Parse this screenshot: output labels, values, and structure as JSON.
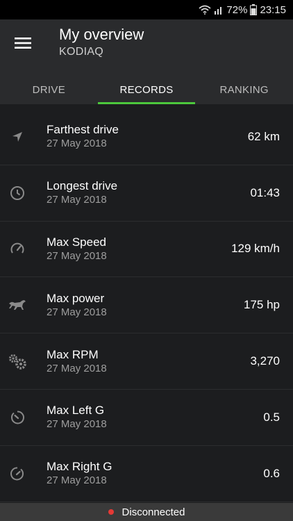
{
  "status_bar": {
    "battery": "72%",
    "time": "23:15"
  },
  "header": {
    "title": "My overview",
    "subtitle": "KODIAQ"
  },
  "tabs": [
    {
      "label": "DRIVE"
    },
    {
      "label": "RECORDS"
    },
    {
      "label": "RANKING"
    }
  ],
  "active_tab": "RECORDS",
  "records": [
    {
      "title": "Farthest drive",
      "date": "27 May 2018",
      "value": "62 km",
      "icon": "navigation-arrow-icon"
    },
    {
      "title": "Longest drive",
      "date": "27 May 2018",
      "value": "01:43",
      "icon": "clock-icon"
    },
    {
      "title": "Max Speed",
      "date": "27 May 2018",
      "value": "129 km/h",
      "icon": "speedometer-icon"
    },
    {
      "title": "Max power",
      "date": "27 May 2018",
      "value": "175 hp",
      "icon": "horse-icon"
    },
    {
      "title": "Max RPM",
      "date": "27 May 2018",
      "value": "3,270",
      "icon": "gears-icon"
    },
    {
      "title": "Max Left G",
      "date": "27 May 2018",
      "value": "0.5",
      "icon": "left-g-icon"
    },
    {
      "title": "Max Right G",
      "date": "27 May 2018",
      "value": "0.6",
      "icon": "right-g-icon"
    }
  ],
  "connection": {
    "status": "Disconnected"
  },
  "colors": {
    "accent": "#4cc83c",
    "disconnected": "#e53935"
  }
}
